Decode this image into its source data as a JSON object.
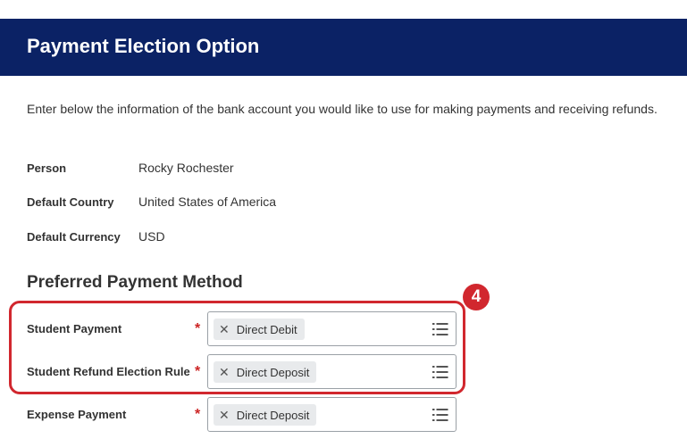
{
  "header": {
    "title": "Payment Election Option"
  },
  "intro": "Enter below the information of the bank account you would like to use for making payments and receiving refunds.",
  "info": {
    "person": {
      "label": "Person",
      "value": "Rocky Rochester"
    },
    "country": {
      "label": "Default Country",
      "value": "United States of America"
    },
    "currency": {
      "label": "Default Currency",
      "value": "USD"
    }
  },
  "section": {
    "title": "Preferred Payment Method"
  },
  "fields": [
    {
      "label": "Student Payment",
      "required": "*",
      "value": "Direct Debit",
      "remove": "✕"
    },
    {
      "label": "Student Refund Election Rule",
      "required": "*",
      "value": "Direct Deposit",
      "remove": "✕"
    },
    {
      "label": "Expense Payment",
      "required": "*",
      "value": "Direct Deposit",
      "remove": "✕"
    }
  ],
  "callout": {
    "number": "4"
  },
  "colors": {
    "header_bg": "#0b2265",
    "required": "#cc2424",
    "callout": "#d1272e"
  },
  "icons": {
    "prompt": "list-icon",
    "remove": "close-icon"
  }
}
